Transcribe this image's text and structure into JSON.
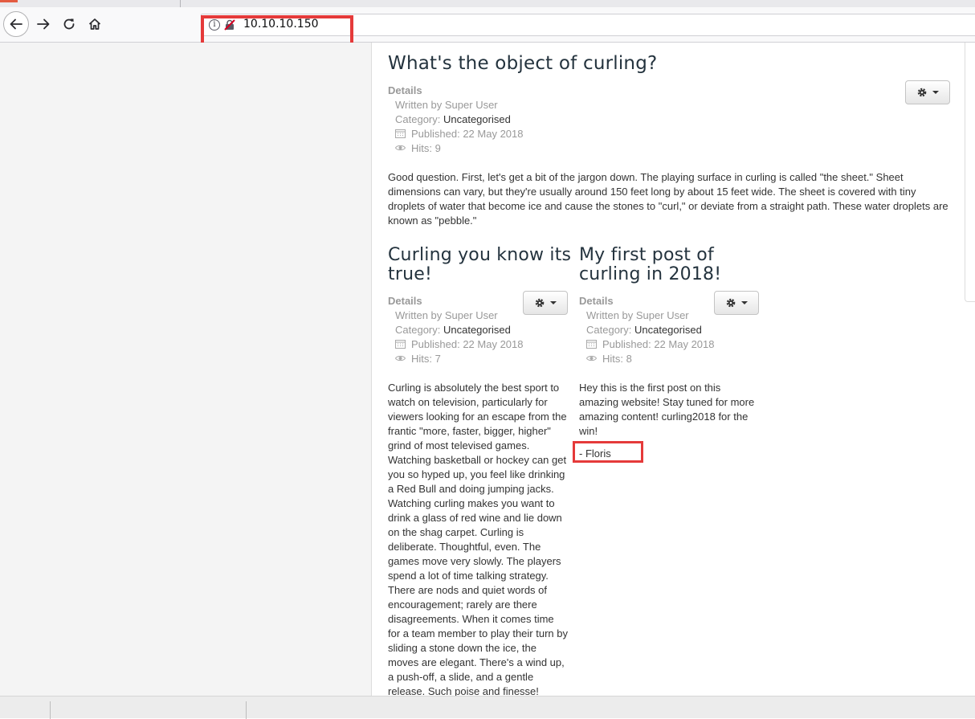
{
  "browser": {
    "url": "10.10.10.150",
    "buttons": {
      "back": "arrow-left-icon",
      "forward": "arrow-right-icon",
      "reload": "reload-icon",
      "home": "home-icon"
    },
    "highlight_color": "#e53a3a"
  },
  "articles": [
    {
      "title": "What's the object of curling?",
      "details_label": "Details",
      "written_by": "Written by Super User",
      "category_label": "Category: ",
      "category": "Uncategorised",
      "published": "Published: 22 May 2018",
      "hits": "Hits: 9",
      "body": "Good question. First, let's get a bit of the jargon down. The playing surface in curling is called \"the sheet.\" Sheet dimensions can vary, but they're usually around 150 feet long by about 15 feet wide. The sheet is covered with tiny droplets of water that become ice and cause the stones to \"curl,\" or deviate from a straight path. These water droplets are known as \"pebble.\""
    },
    {
      "title": "Curling you know its true!",
      "details_label": "Details",
      "written_by": "Written by Super User",
      "category_label": "Category: ",
      "category": "Uncategorised",
      "published": "Published: 22 May 2018",
      "hits": "Hits: 7",
      "body": "Curling is absolutely the best sport to watch on television, particularly for viewers looking for an escape from the frantic \"more, faster, bigger, higher\" grind of most televised games. Watching basketball or hockey can get you so hyped up, you feel like drinking a Red Bull and doing jumping jacks. Watching curling makes you want to drink a glass of red wine and lie down on the shag carpet. Curling is deliberate. Thoughtful, even. The games move very slowly. The players spend a lot of time talking strategy. There are nods and quiet words of encouragement; rarely are there disagreements. When it comes time for a team member to play their turn by sliding a stone down the ice, the moves are elegant. There's a wind up, a push-off, a slide, and a gentle release. Such poise and finesse!"
    },
    {
      "title": "My first post of curling in 2018!",
      "details_label": "Details",
      "written_by": "Written by Super User",
      "category_label": "Category: ",
      "category": "Uncategorised",
      "published": "Published: 22 May 2018",
      "hits": "Hits: 8",
      "body": "Hey this is the first post on this amazing website! Stay tuned for more amazing content! curling2018 for the win!",
      "signature": "- Floris"
    }
  ]
}
